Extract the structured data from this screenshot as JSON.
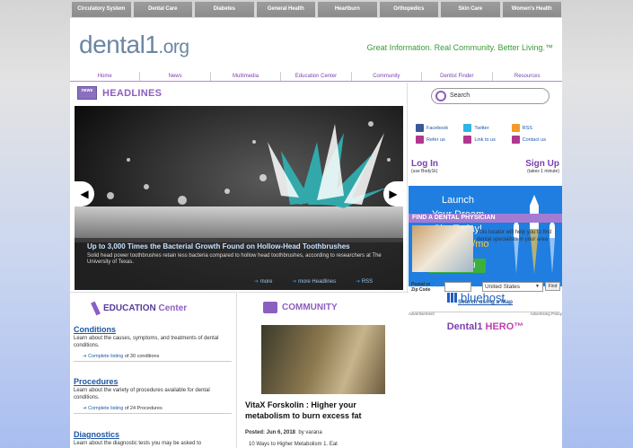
{
  "top_nav": [
    "Circulatory System",
    "Dental Care",
    "Diabetes",
    "General Health",
    "Heartburn",
    "Orthopedics",
    "Skin Care",
    "Women's Health"
  ],
  "logo": {
    "name": "dental1",
    ".org": ".org"
  },
  "tagline": "Great Information.  Real Community.  Better Living.™",
  "sub_nav": [
    "Home",
    "News",
    "Multimedia",
    "Education Center",
    "Community",
    "Dentist Finder",
    "Resources"
  ],
  "headlines": {
    "badge": "news",
    "title": "HEADLINES",
    "slide_title": "Up to 3,000 Times the Bacterial Growth Found on Hollow-Head Toothbrushes",
    "slide_text": "Solid head power toothbrushes retain less bacteria compared to hollow head toothbrushes, according to researchers at The University of Texas.",
    "link_more": "more",
    "link_more_headlines": "more Headlines",
    "link_rss": "RSS"
  },
  "search": {
    "placeholder": "Search"
  },
  "social": [
    {
      "label": "Facebook",
      "color": "#3b5998"
    },
    {
      "label": "Twitter",
      "color": "#2fb4e6"
    },
    {
      "label": "RSS",
      "color": "#f59a28"
    },
    {
      "label": "Refer us",
      "color": "#b2378f"
    },
    {
      "label": "Link to us",
      "color": "#b2378f"
    },
    {
      "label": "Contact us",
      "color": "#b2378f"
    }
  ],
  "login": {
    "title": "Log In",
    "note": "(use Body1k)"
  },
  "signup": {
    "title": "Sign Up",
    "note": "(takes 1 minute)"
  },
  "ad": {
    "line1": "Launch",
    "line2": "Your Dream",
    "line3": "Site Today!",
    "price": "only $2.95/mo",
    "button": "Get Started",
    "brand": "bluehost",
    "foot_left": "Advertisement",
    "foot_right": "Advertising Policy"
  },
  "find_physician": {
    "heading": "FIND A DENTAL PHYSICIAN",
    "text": "This locator will help you to find dental specialists in your area",
    "postal_label": "Postal or Zip Code",
    "country": "United States",
    "find_btn": "Find",
    "map_link": "Search using a Map"
  },
  "hero": {
    "a": "Dental1",
    "b": "HERO™"
  },
  "education": {
    "title": "EDUCATION",
    "title_light": "Center",
    "items": [
      {
        "title": "Conditions",
        "desc": "Learn about the causes, symptoms, and treatments of dental conditions.",
        "link": "Complete listing",
        "count": "of 30 conditions"
      },
      {
        "title": "Procedures",
        "desc": "Learn about the variety of procedures available for dental conditions.",
        "link": "Complete listing",
        "count": "of 24 Procedures"
      },
      {
        "title": "Diagnostics",
        "desc": "Learn about the diagnostic tests you may be asked to"
      }
    ]
  },
  "community": {
    "title": "COMMUNITY",
    "post_title": "VitaX Forskolin : Higher your metabolism to burn excess fat",
    "posted": "Posted: Jun 6, 2018",
    "by": "by varana",
    "excerpt": "10 Ways to Higher Metabolism 1. Eat"
  }
}
